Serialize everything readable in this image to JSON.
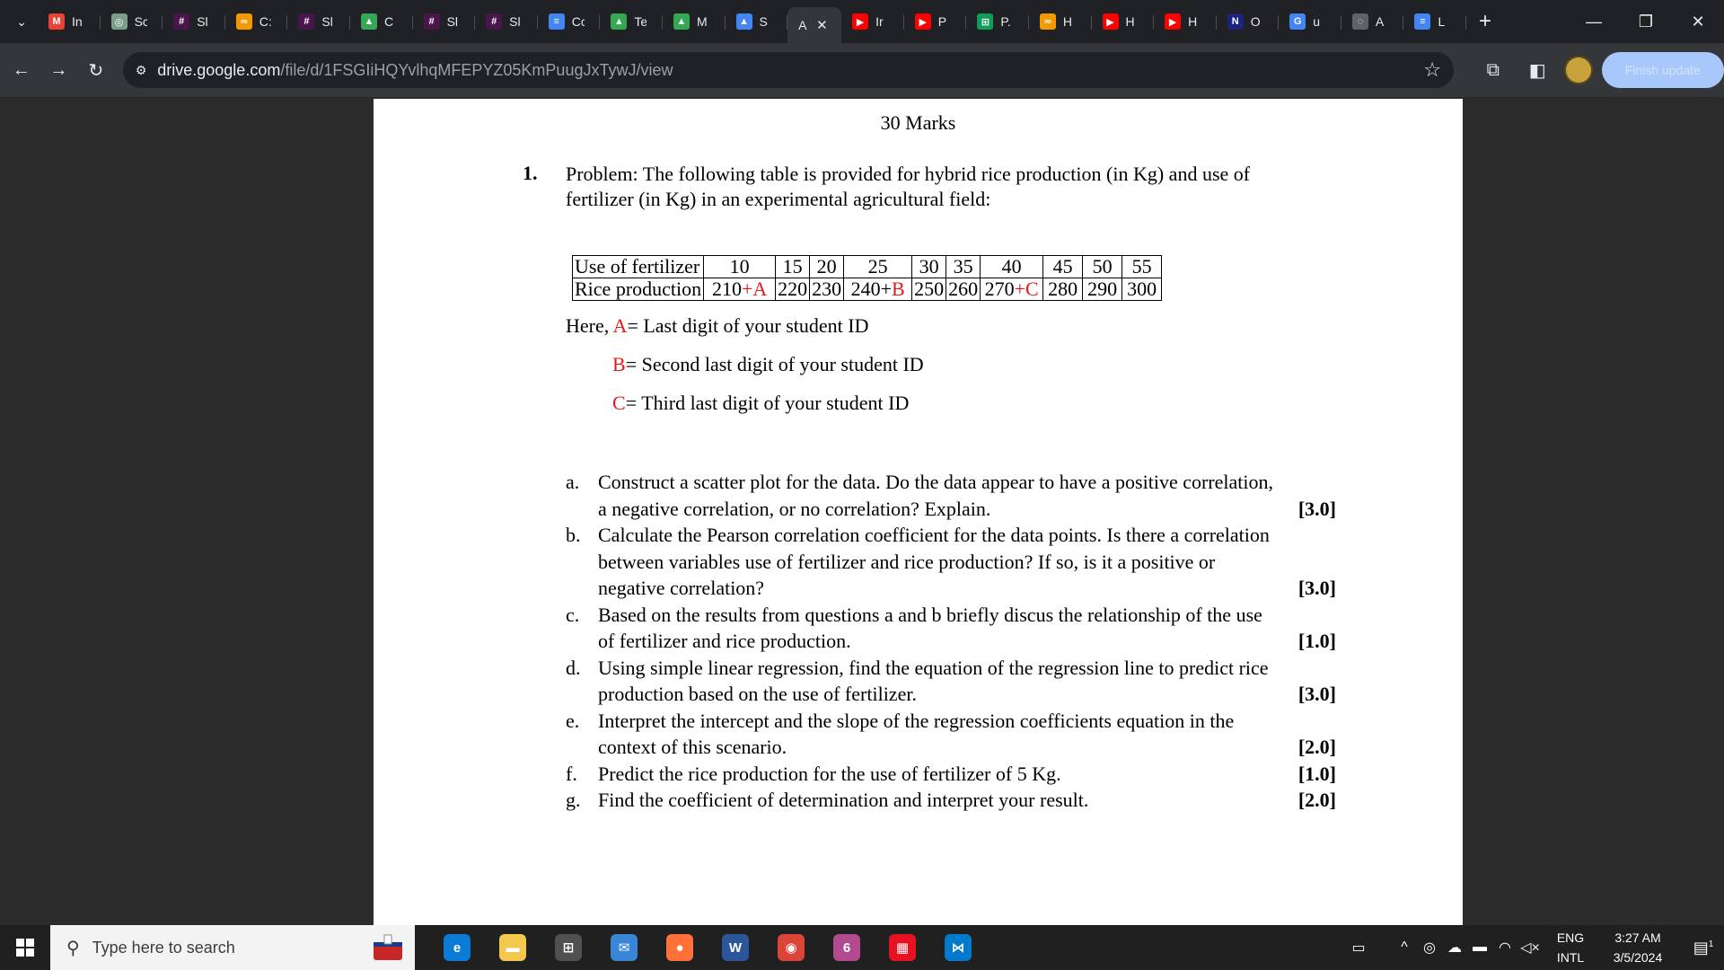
{
  "browser": {
    "tabs": [
      {
        "title": "In",
        "icon": "gmail-icon",
        "color": "#ea4335",
        "glyph": "M"
      },
      {
        "title": "Sc",
        "icon": "chatgpt-icon",
        "color": "#7a9e8a",
        "glyph": "◎"
      },
      {
        "title": "Sl",
        "icon": "slack-icon",
        "color": "#4a154b",
        "glyph": "#"
      },
      {
        "title": "C:",
        "icon": "infinity-icon",
        "color": "#f29900",
        "glyph": "∞"
      },
      {
        "title": "Sl",
        "icon": "slack-icon",
        "color": "#4a154b",
        "glyph": "#"
      },
      {
        "title": "C",
        "icon": "drive-icon",
        "color": "#34a853",
        "glyph": "▲"
      },
      {
        "title": "Sl",
        "icon": "slack-icon",
        "color": "#4a154b",
        "glyph": "#"
      },
      {
        "title": "Sl",
        "icon": "slack-icon",
        "color": "#4a154b",
        "glyph": "#"
      },
      {
        "title": "Cc",
        "icon": "docs-icon",
        "color": "#4285f4",
        "glyph": "≡"
      },
      {
        "title": "Te",
        "icon": "drive-icon",
        "color": "#34a853",
        "glyph": "▲"
      },
      {
        "title": "M",
        "icon": "drive-icon",
        "color": "#34a853",
        "glyph": "▲"
      },
      {
        "title": "S",
        "icon": "image-icon",
        "color": "#4285f4",
        "glyph": "▲"
      },
      {
        "title": "A",
        "icon": "none",
        "color": "#35363a",
        "glyph": "",
        "active": true
      },
      {
        "title": "Ir",
        "icon": "youtube-icon",
        "color": "#ff0000",
        "glyph": "▶"
      },
      {
        "title": "P",
        "icon": "youtube-icon",
        "color": "#ff0000",
        "glyph": "▶"
      },
      {
        "title": "P.",
        "icon": "sheets-icon",
        "color": "#0f9d58",
        "glyph": "⊞"
      },
      {
        "title": "H",
        "icon": "infinity-icon",
        "color": "#f29900",
        "glyph": "∞"
      },
      {
        "title": "H",
        "icon": "youtube-icon",
        "color": "#ff0000",
        "glyph": "▶"
      },
      {
        "title": "H",
        "icon": "youtube-icon",
        "color": "#ff0000",
        "glyph": "▶"
      },
      {
        "title": "O",
        "icon": "nkc-icon",
        "color": "#1a237e",
        "glyph": "N"
      },
      {
        "title": "u",
        "icon": "google-icon",
        "color": "#4285f4",
        "glyph": "G"
      },
      {
        "title": "A",
        "icon": "chat-icon",
        "color": "#5f6368",
        "glyph": "◌"
      },
      {
        "title": "L",
        "icon": "docs-icon",
        "color": "#4285f4",
        "glyph": "≡"
      }
    ],
    "url_host": "drive.google.com",
    "url_path": "/file/d/1FSGIiHQYvlhqMFEPYZ05KmPuugJxTywJ/view",
    "finish_update_label": "Finish update"
  },
  "document": {
    "marks": "30 Marks",
    "question_number": "1.",
    "problem_text": "Problem: The following table is provided for hybrid rice production (in Kg) and use of fertilizer (in Kg) in an experimental agricultural field:",
    "table": {
      "row1_head": "Use of fertilizer",
      "row1": [
        "10",
        "15",
        "20",
        "25",
        "30",
        "35",
        "40",
        "45",
        "50",
        "55"
      ],
      "row2_head": "Rice production",
      "row2": [
        {
          "base": "210",
          "plus": "+A"
        },
        {
          "base": "220",
          "plus": ""
        },
        {
          "base": "230",
          "plus": ""
        },
        {
          "base": "240+",
          "plus": "B"
        },
        {
          "base": "250",
          "plus": ""
        },
        {
          "base": "260",
          "plus": ""
        },
        {
          "base": "270",
          "plus": "+C"
        },
        {
          "base": "280",
          "plus": ""
        },
        {
          "base": "290",
          "plus": ""
        },
        {
          "base": "300",
          "plus": ""
        }
      ]
    },
    "here_prefix": "Here,",
    "def_A_var": "A",
    "def_A_text": "= Last digit of your student ID",
    "def_B_var": "B",
    "def_B_text": "= Second last digit of your student ID",
    "def_C_var": "C",
    "def_C_text": "= Third last digit of your student ID",
    "questions": [
      {
        "label": "a.",
        "lines": [
          "Construct a scatter plot for the data. Do the data appear to have a positive correlation,",
          "a negative correlation, or no correlation? Explain."
        ],
        "mark": "[3.0]"
      },
      {
        "label": "b.",
        "lines": [
          "Calculate the Pearson correlation coefficient for the data points. Is there a correlation",
          "between variables use of fertilizer and rice production? If so, is it a positive or",
          "negative correlation?"
        ],
        "mark": "[3.0]"
      },
      {
        "label": "c.",
        "lines": [
          "Based on the results from questions a and b briefly discus the relationship of the use",
          "of fertilizer and rice production."
        ],
        "mark": "[1.0]"
      },
      {
        "label": "d.",
        "lines": [
          "Using simple linear regression, find the equation of the regression line to predict rice",
          "production based on the use of fertilizer."
        ],
        "mark": "[3.0]"
      },
      {
        "label": "e.",
        "lines": [
          "Interpret the intercept and the slope of the regression coefficients equation in the",
          "context of this scenario."
        ],
        "mark": "[2.0]"
      },
      {
        "label": "f.",
        "lines": [
          "Predict the rice production for the use of fertilizer of 5 Kg."
        ],
        "mark": "[1.0]"
      },
      {
        "label": "g.",
        "lines": [
          "Find the coefficient of determination and interpret your result."
        ],
        "mark": "[2.0]"
      }
    ]
  },
  "taskbar": {
    "search_placeholder": "Type here to search",
    "apps": [
      {
        "name": "edge-icon",
        "color": "#0c7bd6",
        "glyph": "e"
      },
      {
        "name": "file-explorer-icon",
        "color": "#f2c94c",
        "glyph": "▬"
      },
      {
        "name": "store-icon",
        "color": "#505050",
        "glyph": "⊞"
      },
      {
        "name": "mail-icon",
        "color": "#3a86d6",
        "glyph": "✉"
      },
      {
        "name": "firefox-icon",
        "color": "#ff7139",
        "glyph": "●"
      },
      {
        "name": "word-icon",
        "color": "#2b579a",
        "glyph": "W"
      },
      {
        "name": "chrome-icon",
        "color": "#db4437",
        "glyph": "◉"
      },
      {
        "name": "paint-icon",
        "color": "#b24a8f",
        "glyph": "6"
      },
      {
        "name": "windows-app-icon",
        "color": "#e81123",
        "glyph": "▦"
      },
      {
        "name": "vscode-icon",
        "color": "#007acc",
        "glyph": "⋈"
      }
    ],
    "lang_top": "ENG",
    "lang_bottom": "INTL",
    "time": "3:27 AM",
    "date": "3/5/2024",
    "notification_count": "1"
  }
}
